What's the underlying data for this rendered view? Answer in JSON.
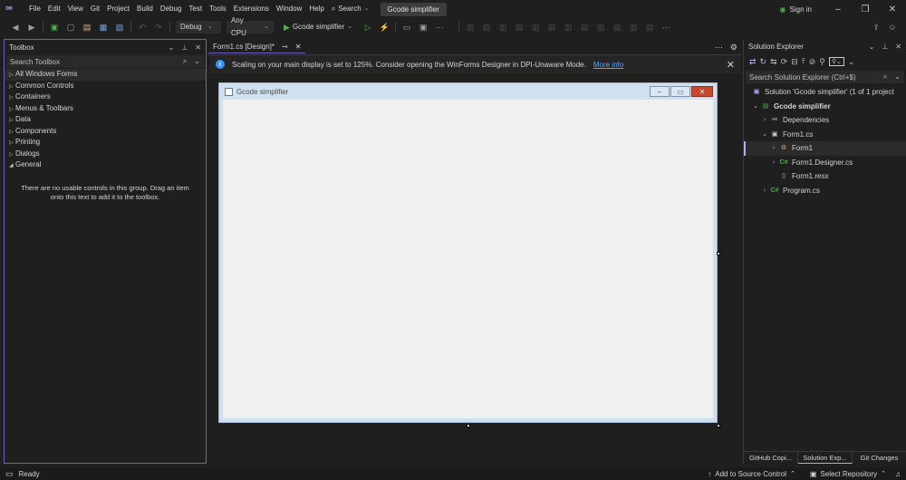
{
  "menu": {
    "items": [
      "File",
      "Edit",
      "View",
      "Git",
      "Project",
      "Build",
      "Debug",
      "Test",
      "Tools",
      "Extensions",
      "Window",
      "Help"
    ],
    "search_label": "Search",
    "app_title": "Gcode simplifier",
    "sign_in": "Sign in"
  },
  "toolbar": {
    "config": "Debug",
    "platform": "Any CPU",
    "run_target": "Gcode simplifier"
  },
  "toolbox": {
    "title": "Toolbox",
    "search_placeholder": "Search Toolbox",
    "groups": [
      "All Windows Forms",
      "Common Controls",
      "Containers",
      "Menus & Toolbars",
      "Data",
      "Components",
      "Printing",
      "Dialogs",
      "General"
    ],
    "empty_message": "There are no usable controls in this group. Drag an item onto this text to add it to the toolbox."
  },
  "document": {
    "tab_label": "Form1.cs [Design]*",
    "info_message": "Scaling on your main display is set to 125%. Consider opening the WinForms Designer in DPI-Unaware Mode.",
    "info_link": "More info",
    "form_title": "Gcode simplifier"
  },
  "solution_explorer": {
    "title": "Solution Explorer",
    "search_placeholder": "Search Solution Explorer (Ctrl+$)",
    "solution": "Solution 'Gcode simplifier' (1 of 1 project",
    "project": "Gcode simplifier",
    "items": {
      "dependencies": "Dependencies",
      "form1cs": "Form1.cs",
      "form1": "Form1",
      "designer": "Form1.Designer.cs",
      "resx": "Form1.resx",
      "program": "Program.cs"
    },
    "tabs": [
      "GitHub Copi...",
      "Solution Exp...",
      "Git Changes"
    ]
  },
  "status": {
    "ready": "Ready",
    "source_control": "Add to Source Control",
    "repository": "Select Repository"
  }
}
